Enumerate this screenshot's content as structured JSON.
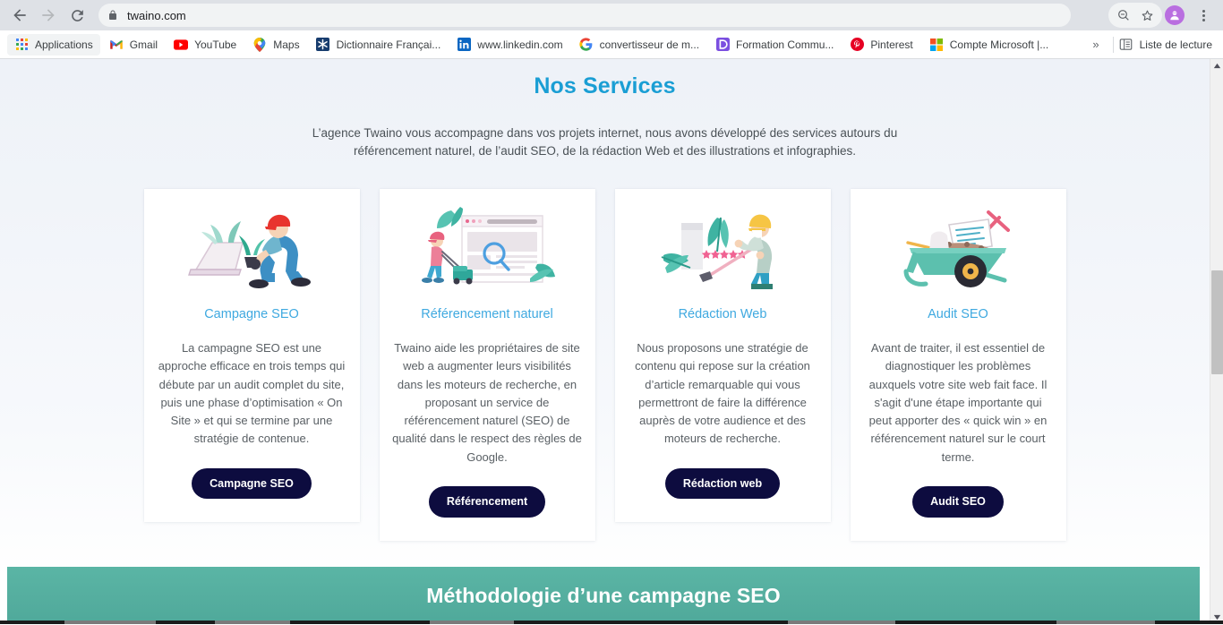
{
  "browser": {
    "url": "twaino.com",
    "nav": {
      "back": "back-arrow",
      "forward": "forward-arrow",
      "reload": "reload"
    },
    "omnibox_actions": [
      "zoom-out-icon",
      "bookmark-star-icon"
    ],
    "toolbar_right": [
      "extensions-puzzle-icon",
      "profile-avatar",
      "chrome-menu"
    ],
    "bookmarks": [
      {
        "label": "Applications",
        "icon": "apps-grid-icon"
      },
      {
        "label": "Gmail",
        "icon": "gmail-icon"
      },
      {
        "label": "YouTube",
        "icon": "youtube-icon"
      },
      {
        "label": "Maps",
        "icon": "google-maps-icon"
      },
      {
        "label": "Dictionnaire Françai...",
        "icon": "dictionary-icon"
      },
      {
        "label": "www.linkedin.com",
        "icon": "linkedin-icon"
      },
      {
        "label": "convertisseur de m...",
        "icon": "google-icon"
      },
      {
        "label": "Formation Commu...",
        "icon": "formation-icon"
      },
      {
        "label": "Pinterest",
        "icon": "pinterest-icon"
      },
      {
        "label": "Compte Microsoft |...",
        "icon": "microsoft-icon"
      }
    ],
    "bookmarks_overflow": "»",
    "reading_list": {
      "label": "Liste de lecture",
      "icon": "reading-list-icon"
    }
  },
  "page": {
    "section_title": "Nos Services",
    "section_intro": "L’agence Twaino vous accompagne dans vos projets internet, nous avons développé des services autours du référencement naturel, de l’audit SEO, de la rédaction Web et des illustrations et infographies.",
    "cards": [
      {
        "illustration": "gardener-planting-laptop-illustration",
        "title": "Campagne SEO",
        "text": "La campagne SEO est une approche efficace en trois temps qui débute par un audit complet du site, puis une phase d’optimisation « On Site » et qui se termine par une stratégie de contenue.",
        "button": "Campagne SEO"
      },
      {
        "illustration": "lawnmower-browser-search-illustration",
        "title": "Référencement naturel",
        "text": "Twaino aide les propriétaires de site web a augmenter leurs visibilités dans les moteurs de recherche, en proposant un service de référencement naturel (SEO) de qualité dans le respect des règles de Google.",
        "button": "Référencement"
      },
      {
        "illustration": "trimmer-worker-stars-illustration",
        "title": "Rédaction Web",
        "text": "Nous proposons une stratégie de contenu qui repose sur la création d’article remarquable qui vous permettront de faire la différence auprès de votre audience et des moteurs de recherche.",
        "button": "Rédaction web"
      },
      {
        "illustration": "wheelbarrow-laptop-tools-illustration",
        "title": "Audit SEO",
        "text": "Avant de traiter, il est essentiel de diagnostiquer les problèmes auxquels votre site web fait face. Il s'agit d'une étape importante qui peut apporter des « quick win » en référencement naturel sur le court terme.",
        "button": "Audit SEO"
      }
    ],
    "banner_title": "Méthodologie d’une campagne SEO"
  },
  "colors": {
    "heading_blue": "#1a9ed4",
    "card_title_blue": "#3fa9e0",
    "button_navy": "#0d0c3f",
    "banner_teal": "#55ae9f",
    "page_bg_top": "#eef2f8"
  }
}
